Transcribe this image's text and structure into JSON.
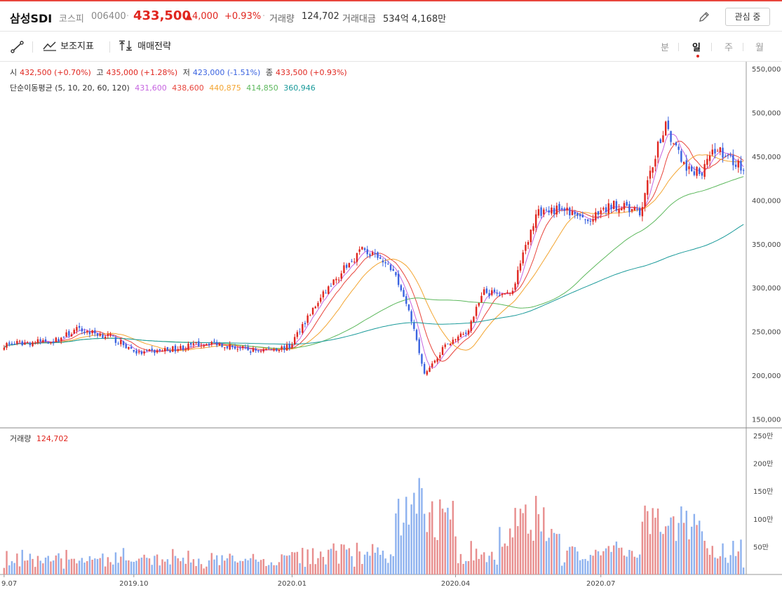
{
  "header": {
    "name": "삼성SDI",
    "market": "코스피",
    "code": "006400",
    "price": "433,500",
    "change": "▲4,000",
    "change_pct": "+0.93%",
    "volume_label": "거래량",
    "volume": "124,702",
    "amount_label": "거래대금",
    "amount": "534억 4,168만",
    "watch_button": "관심 중"
  },
  "toolbar": {
    "indicators_label": "보조지표",
    "strategy_label": "매매전략",
    "periods": [
      "분",
      "일",
      "주",
      "월"
    ],
    "active_period": "일"
  },
  "ohlc": {
    "open_label": "시",
    "open": "432,500 (+0.70%)",
    "high_label": "고",
    "high": "435,000 (+1.28%)",
    "low_label": "저",
    "low": "423,000 (-1.51%)",
    "close_label": "종",
    "close": "433,500 (+0.93%)"
  },
  "ma_legend": {
    "label": "단순이동평균 (5, 10, 20, 60, 120)",
    "values": [
      "431,600",
      "438,600",
      "440,875",
      "414,850",
      "360,946"
    ],
    "colors": [
      "#c665e0",
      "#e8453c",
      "#f3a531",
      "#5cb85c",
      "#1a9a9a"
    ]
  },
  "volume_legend": {
    "label": "거래량",
    "value": "124,702"
  },
  "colors": {
    "up": "#e0261f",
    "down": "#3a63e0",
    "vol_up": "#e88e8e",
    "vol_down": "#8eb2ef"
  },
  "chart_data": {
    "type": "candlestick",
    "price_axis": {
      "ticks": [
        550000,
        500000,
        450000,
        400000,
        350000,
        300000,
        250000,
        200000,
        150000
      ],
      "tick_labels": [
        "550,000",
        "500,000",
        "450,000",
        "400,000",
        "350,000",
        "300,000",
        "250,000",
        "200,000",
        "150,000"
      ],
      "range": [
        140000,
        550000
      ]
    },
    "volume_axis": {
      "ticks": [
        250,
        200,
        150,
        100,
        50
      ],
      "tick_labels": [
        "250만",
        "200만",
        "150만",
        "100만",
        "50만"
      ],
      "unit": "만"
    },
    "x_labels": [
      "9.07",
      "2019.10",
      "2020.01",
      "2020.04",
      "2020.07"
    ],
    "close_keypoints": [
      [
        0,
        235000
      ],
      [
        20,
        240000
      ],
      [
        28,
        252000
      ],
      [
        40,
        245000
      ],
      [
        52,
        225000
      ],
      [
        65,
        230000
      ],
      [
        80,
        238000
      ],
      [
        95,
        228000
      ],
      [
        110,
        232000
      ],
      [
        115,
        258000
      ],
      [
        125,
        300000
      ],
      [
        138,
        345000
      ],
      [
        150,
        320000
      ],
      [
        156,
        278000
      ],
      [
        162,
        200000
      ],
      [
        170,
        235000
      ],
      [
        178,
        248000
      ],
      [
        185,
        295000
      ],
      [
        195,
        290000
      ],
      [
        205,
        385000
      ],
      [
        215,
        390000
      ],
      [
        225,
        375000
      ],
      [
        235,
        395000
      ],
      [
        245,
        385000
      ],
      [
        252,
        460000
      ],
      [
        255,
        485000
      ],
      [
        262,
        440000
      ],
      [
        268,
        430000
      ],
      [
        275,
        460000
      ],
      [
        285,
        433500
      ]
    ],
    "last_close": 433500,
    "last_volume": 124702,
    "moving_averages": [
      5,
      10,
      20,
      60,
      120
    ],
    "ma_last": [
      431600,
      438600,
      440875,
      414850,
      360946
    ]
  }
}
